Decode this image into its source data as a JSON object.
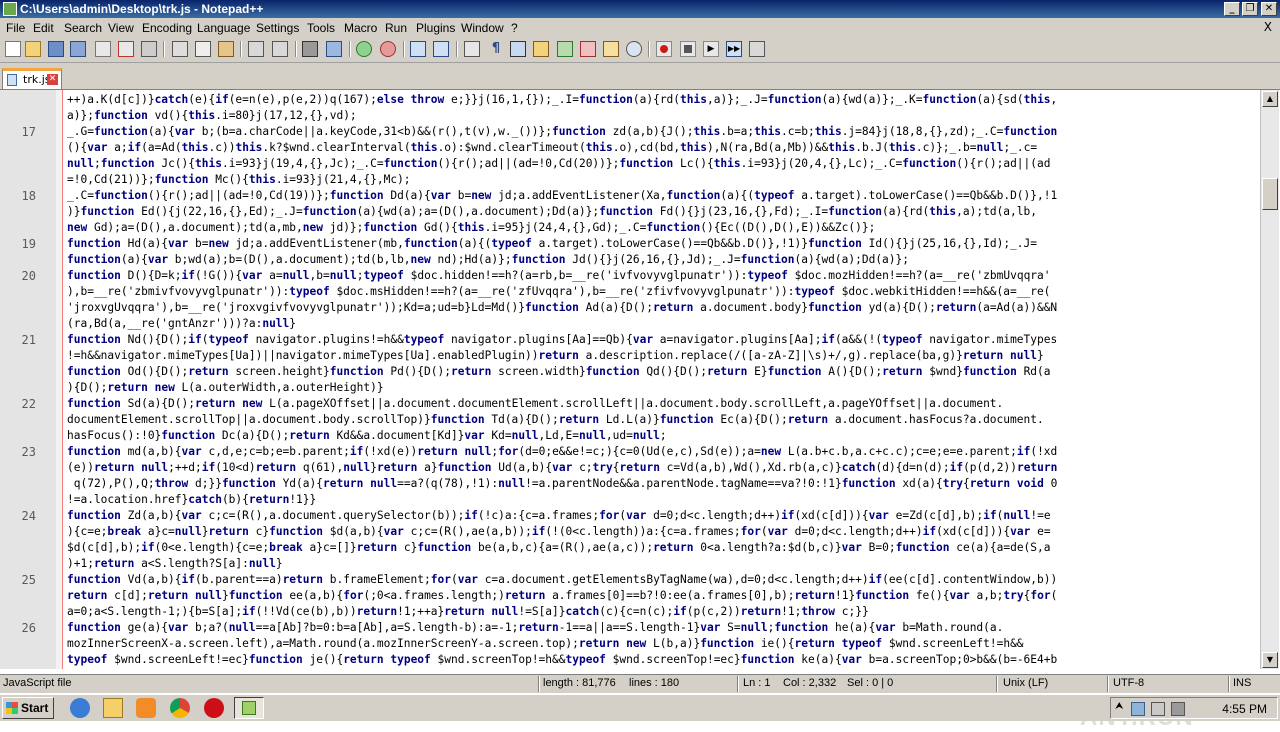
{
  "window": {
    "title": "C:\\Users\\admin\\Desktop\\trk.js - Notepad++",
    "minimize": "_",
    "restore": "❐",
    "close": "✕"
  },
  "menu": [
    "File",
    "Edit",
    "Search",
    "View",
    "Encoding",
    "Language",
    "Settings",
    "Tools",
    "Macro",
    "Run",
    "Plugins",
    "Window",
    "?"
  ],
  "menu_close": "X",
  "toolbar_icons": [
    "new-file-icon",
    "open-file-icon",
    "save-icon",
    "save-all-icon",
    "close-icon",
    "close-all-icon",
    "print-icon",
    "cut-icon",
    "copy-icon",
    "paste-icon",
    "undo-icon",
    "redo-icon",
    "find-icon",
    "replace-icon",
    "zoom-in-icon",
    "zoom-out-icon",
    "sync-v-icon",
    "sync-h-icon",
    "word-wrap-icon",
    "show-all-chars-icon",
    "indent-guide-icon",
    "udl-icon",
    "doc-map-icon",
    "function-list-icon",
    "folder-workspace-icon",
    "monitor-icon",
    "record-macro-icon",
    "stop-record-icon",
    "play-macro-icon",
    "run-macro-multiple-icon",
    "save-macro-icon"
  ],
  "tab": {
    "label": "trk.js",
    "close": "✕"
  },
  "editor": {
    "lines": [
      {
        "num": "",
        "text": "++)a.K(d[c])}catch(e){if(e=n(e),p(e,2))q(167);else throw e;}}j(16,1,{});_.I=function(a){rd(this,a)};_.J=function(a){wd(a)};_.K=function(a){sd(this,"
      },
      {
        "num": "",
        "text": "a)};function vd(){this.i=80}j(17,12,{},vd);"
      },
      {
        "num": "17",
        "text": "_.G=function(a){var b;(b=a.charCode||a.keyCode,31<b)&&(r(),t(v),w._())};function zd(a,b){J();this.b=a;this.c=b;this.j=84}j(18,8,{},zd);_.C=function"
      },
      {
        "num": "",
        "text": "(){var a;if(a=Ad(this.c))this.k?$wnd.clearInterval(this.o):$wnd.clearTimeout(this.o),cd(bd,this),N(ra,Bd(a,Mb))&&this.b.J(this.c)};_.b=null;_.c="
      },
      {
        "num": "",
        "text": "null;function Jc(){this.i=93}j(19,4,{},Jc);_.C=function(){r();ad||(ad=!0,Cd(20))};function Lc(){this.i=93}j(20,4,{},Lc);_.C=function(){r();ad||(ad"
      },
      {
        "num": "",
        "text": "=!0,Cd(21))};function Mc(){this.i=93}j(21,4,{},Mc);"
      },
      {
        "num": "18",
        "text": "_.C=function(){r();ad||(ad=!0,Cd(19))};function Dd(a){var b=new jd;a.addEventListener(Xa,function(a){(typeof a.target).toLowerCase()==Qb&&b.D()},!1"
      },
      {
        "num": "",
        "text": ")}function Ed(){j(22,16,{},Ed);_.J=function(a){wd(a);a=(D(),a.document);Dd(a)};function Fd(){}j(23,16,{},Fd);_.I=function(a){rd(this,a);td(a,lb,"
      },
      {
        "num": "",
        "text": "new Gd);a=(D(),a.document);td(a,mb,new jd)};function Gd(){this.i=95}j(24,4,{},Gd);_.C=function(){Ec((D(),D(),E))&&Zc()};"
      },
      {
        "num": "19",
        "text": "function Hd(a){var b=new jd;a.addEventListener(mb,function(a){(typeof a.target).toLowerCase()==Qb&&b.D()},!1)}function Id(){}j(25,16,{},Id);_.J="
      },
      {
        "num": "",
        "text": "function(a){var b;wd(a);b=(D(),a.document);td(b,lb,new nd);Hd(a)};function Jd(){}j(26,16,{},Jd);_.J=function(a){wd(a);Dd(a)};"
      },
      {
        "num": "20",
        "text": "function D(){D=k;if(!G()){var a=null,b=null;typeof $doc.hidden!==h?(a=rb,b=__re('ivfvovyvglpunatr')):typeof $doc.mozHidden!==h?(a=__re('zbmUvqqra'"
      },
      {
        "num": "",
        "text": "),b=__re('zbmivfvovyvglpunatr')):typeof $doc.msHidden!==h?(a=__re('zfUvqqra'),b=__re('zfivfvovyvglpunatr')):typeof $doc.webkitHidden!==h&&(a=__re("
      },
      {
        "num": "",
        "text": "'jroxvgUvqqra'),b=__re('jroxvgivfvovyvglpunatr'));Kd=a;ud=b}Ld=Md()}function Ad(a){D();return a.document.body}function yd(a){D();return(a=Ad(a))&&N"
      },
      {
        "num": "",
        "text": "(ra,Bd(a,__re('gntAnzr')))?a:null}"
      },
      {
        "num": "21",
        "text": "function Nd(){D();if(typeof navigator.plugins!=h&&typeof navigator.plugins[Aa]==Qb){var a=navigator.plugins[Aa];if(a&&(!(typeof navigator.mimeTypes"
      },
      {
        "num": "",
        "text": "!=h&&navigator.mimeTypes[Ua])||navigator.mimeTypes[Ua].enabledPlugin))return a.description.replace(/([a-zA-Z]|\\s)+/,g).replace(ba,g)}return null}"
      },
      {
        "num": "",
        "text": "function Od(){D();return screen.height}function Pd(){D();return screen.width}function Qd(){D();return E}function A(){D();return $wnd}function Rd(a"
      },
      {
        "num": "",
        "text": "){D();return new L(a.outerWidth,a.outerHeight)}"
      },
      {
        "num": "22",
        "text": "function Sd(a){D();return new L(a.pageXOffset||a.document.documentElement.scrollLeft||a.document.body.scrollLeft,a.pageYOffset||a.document."
      },
      {
        "num": "",
        "text": "documentElement.scrollTop||a.document.body.scrollTop)}function Td(a){D();return Ld.L(a)}function Ec(a){D();return a.document.hasFocus?a.document."
      },
      {
        "num": "",
        "text": "hasFocus():!0}function Dc(a){D();return Kd&&a.document[Kd]}var Kd=null,Ld,E=null,ud=null;"
      },
      {
        "num": "23",
        "text": "function md(a,b){var c,d,e;c=b;e=b.parent;if(!xd(e))return null;for(d=0;e&&e!=c;){c=0(Ud(e,c),Sd(e));a=new L(a.b+c.b,a.c+c.c);c=e;e=e.parent;if(!xd"
      },
      {
        "num": "",
        "text": "(e))return null;++d;if(10<d)return q(61),null}return a}function Ud(a,b){var c;try{return c=Vd(a,b),Wd(),Xd.rb(a,c)}catch(d){d=n(d);if(p(d,2))return"
      },
      {
        "num": "",
        "text": " q(72),P(),Q;throw d;}}function Yd(a){return null==a?(q(78),!1):null!=a.parentNode&&a.parentNode.tagName==va?!0:!1}function xd(a){try{return void 0"
      },
      {
        "num": "",
        "text": "!=a.location.href}catch(b){return!1}}"
      },
      {
        "num": "24",
        "text": "function Zd(a,b){var c;c=(R(),a.document.querySelector(b));if(!c)a:{c=a.frames;for(var d=0;d<c.length;d++)if(xd(c[d])){var e=Zd(c[d],b);if(null!=e"
      },
      {
        "num": "",
        "text": "){c=e;break a}c=null}return c}function $d(a,b){var c;c=(R(),ae(a,b));if(!(0<c.length))a:{c=a.frames;for(var d=0;d<c.length;d++)if(xd(c[d])){var e="
      },
      {
        "num": "",
        "text": "$d(c[d],b);if(0<e.length){c=e;break a}c=[]}return c}function be(a,b,c){a=(R(),ae(a,c));return 0<a.length?a:$d(b,c)}var B=0;function ce(a){a=de(S,a"
      },
      {
        "num": "",
        "text": ")+1;return a<S.length?S[a]:null}"
      },
      {
        "num": "25",
        "text": "function Vd(a,b){if(b.parent==a)return b.frameElement;for(var c=a.document.getElementsByTagName(wa),d=0;d<c.length;d++)if(ee(c[d].contentWindow,b))"
      },
      {
        "num": "",
        "text": "return c[d];return null}function ee(a,b){for(;0<a.frames.length;)return a.frames[0]==b?!0:ee(a.frames[0],b);return!1}function fe(){var a,b;try{for("
      },
      {
        "num": "",
        "text": "a=0;a<S.length-1;){b=S[a];if(!!Vd(ce(b),b))return!1;++a}return null!=S[a]}catch(c){c=n(c);if(p(c,2))return!1;throw c;}}"
      },
      {
        "num": "26",
        "text": "function ge(a){var b;a?(null==a[Ab]?b=0:b=a[Ab],a=S.length-b):a=-1;return-1==a||a==S.length-1}var S=null;function he(a){var b=Math.round(a."
      },
      {
        "num": "",
        "text": "mozInnerScreenX-a.screen.left),a=Math.round(a.mozInnerScreenY-a.screen.top);return new L(b,a)}function ie(){return typeof $wnd.screenLeft!=h&&"
      },
      {
        "num": "",
        "text": "typeof $wnd.screenLeft!=ec}function je(){return typeof $wnd.screenTop!=h&&typeof $wnd.screenTop!=ec}function ke(a){var b=a.screenTop;0>b&&(b=-6E4+b"
      }
    ]
  },
  "status": {
    "language": "JavaScript file",
    "length": "length : 81,776",
    "lines": "lines : 180",
    "ln": "Ln : 1",
    "col": "Col : 2,332",
    "sel": "Sel : 0 | 0",
    "eol": "Unix (LF)",
    "encoding": "UTF-8",
    "mode": "INS"
  },
  "taskbar": {
    "start": "Start",
    "apps": [
      "ie-icon",
      "explorer-icon",
      "media-player-icon",
      "chrome-icon",
      "opera-icon",
      "notepadpp-icon"
    ],
    "clock": "4:55 PM"
  },
  "watermark": "ANY.RUN"
}
